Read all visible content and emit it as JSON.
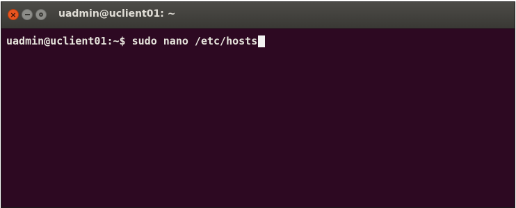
{
  "window": {
    "title": "uadmin@uclient01: ~",
    "buttons": {
      "close_icon": "close-icon",
      "minimize_icon": "minimize-icon",
      "maximize_icon": "maximize-icon"
    }
  },
  "terminal": {
    "prompt": "uadmin@uclient01:~$",
    "command": "sudo nano /etc/hosts"
  },
  "colors": {
    "terminal_background": "#2d0922",
    "text": "#e6e4dc",
    "titlebar": "#3a3935",
    "close_button": "#e9541f"
  }
}
